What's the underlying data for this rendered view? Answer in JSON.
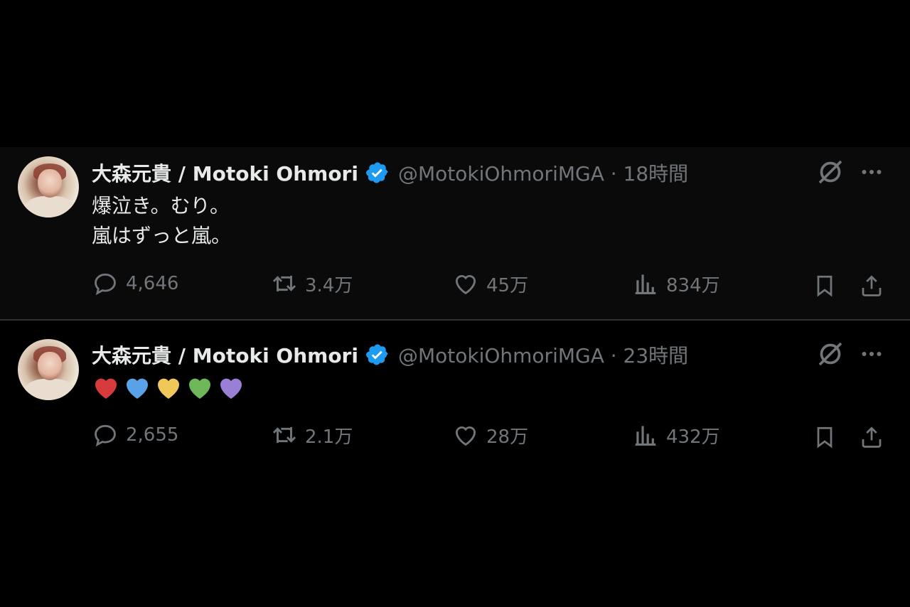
{
  "tweets": [
    {
      "author_name": "大森元貴 / Motoki Ohmori",
      "handle_time": "@MotokiOhmoriMGA · 18時間",
      "lines": [
        "爆泣き。むり。",
        "嵐はずっと嵐。"
      ],
      "replies": "4,646",
      "reposts": "3.4万",
      "likes": "45万",
      "views": "834万"
    },
    {
      "author_name": "大森元貴 / Motoki Ohmori",
      "handle_time": "@MotokiOhmoriMGA · 23時間",
      "emoji_hearts": [
        "#d63a3a",
        "#5aa2e8",
        "#f0c85a",
        "#6fb85a",
        "#9a7fd6"
      ],
      "replies": "2,655",
      "reposts": "2.1万",
      "likes": "28万",
      "views": "432万"
    }
  ],
  "icons": {
    "verified": "verified-badge-icon",
    "grok": "grok-icon",
    "more": "more-icon",
    "reply": "reply-icon",
    "repost": "repost-icon",
    "like": "like-icon",
    "views": "views-icon",
    "bookmark": "bookmark-icon",
    "share": "share-icon"
  },
  "colors": {
    "background": "#000000",
    "text": "#e7e9ea",
    "muted": "#71767b",
    "verified": "#1d9bf0"
  }
}
